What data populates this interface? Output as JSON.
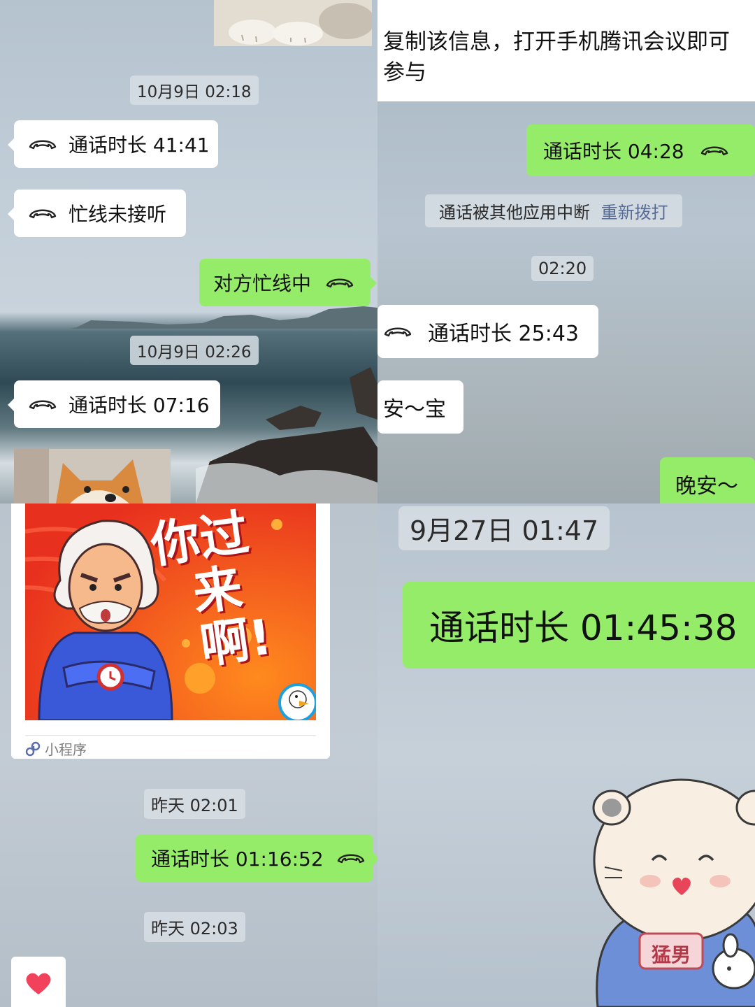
{
  "panel_top_left": {
    "timestamp_1": "10月9日 02:18",
    "call_1": "通话时长 41:41",
    "call_2": "忙线未接听",
    "call_3": "对方忙线中",
    "timestamp_2": "10月9日 02:26",
    "call_4": "通话时长 07:16"
  },
  "panel_top_right": {
    "message_text": "复制该信息，打开手机腾讯会议即可参与",
    "call_1": "通话时长 04:28",
    "system_notice": "通话被其他应用中断",
    "redial_link": "重新拨打",
    "timestamp": "02:20",
    "call_2": "通话时长 25:43",
    "message_1": "安～宝",
    "message_2": "晚安～"
  },
  "panel_bottom_left": {
    "mini_program_title_line1": "你过",
    "mini_program_title_line2": "来啊!",
    "mini_program_label": "小程序",
    "timestamp_1": "昨天 02:01",
    "call_1": "通话时长 01:16:52",
    "timestamp_2": "昨天 02:03"
  },
  "panel_bottom_right": {
    "timestamp": "9月27日 01:47",
    "call_1": "通话时长 01:45:38",
    "sticker_shirt_text": "猛男"
  },
  "colors": {
    "green_bubble": "#95ec69",
    "white_bubble": "#ffffff",
    "link_blue": "#576b95",
    "timestamp_bg": "#d7dee4"
  },
  "icons": [
    "phone-handset-icon",
    "mini-program-icon",
    "heart-icon",
    "duck-logo-icon"
  ]
}
